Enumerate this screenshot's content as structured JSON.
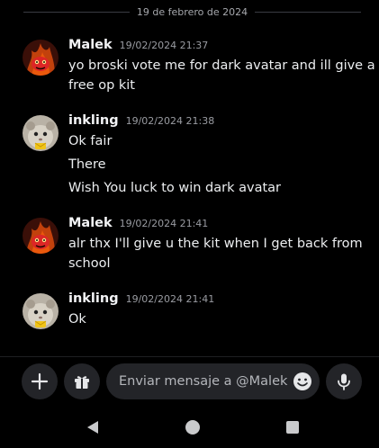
{
  "date_divider": "19 de febrero de 2024",
  "messages": [
    {
      "author": "Malek",
      "timestamp": "19/02/2024 21:37",
      "lines": [
        "yo broski vote me for dark avatar and ill give a",
        "free op kit"
      ]
    },
    {
      "author": "inkling",
      "timestamp": "19/02/2024 21:38",
      "lines": [
        "Ok fair",
        "There",
        "Wish You luck to win dark avatar"
      ]
    },
    {
      "author": "Malek",
      "timestamp": "19/02/2024 21:41",
      "lines": [
        "alr thx I'll give u the kit when I get back from",
        "school"
      ]
    },
    {
      "author": "inkling",
      "timestamp": "19/02/2024 21:41",
      "lines": [
        "Ok"
      ]
    }
  ],
  "composer": {
    "placeholder": "Enviar mensaje a @Malek",
    "buttons": [
      "plus-icon",
      "gift-icon",
      "emoji-icon",
      "microphone-icon"
    ]
  },
  "nav_bar": {
    "buttons": [
      "back-triangle-icon",
      "home-circle-icon",
      "recents-square-icon"
    ]
  },
  "colors": {
    "background": "#000000",
    "button_background": "#232428",
    "text": "#f2f3f5",
    "muted_text": "#9a9ca2"
  }
}
